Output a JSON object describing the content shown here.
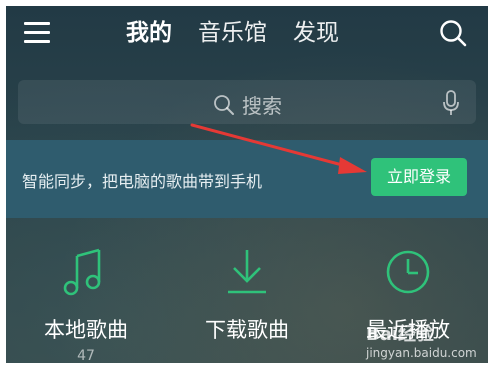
{
  "header": {
    "tabs": [
      {
        "label": "我的",
        "active": true
      },
      {
        "label": "音乐馆",
        "active": false
      },
      {
        "label": "发现",
        "active": false
      }
    ],
    "menu_icon": "hamburger-menu-icon",
    "search_icon": "search-icon"
  },
  "search": {
    "placeholder": "搜索",
    "icon": "search-icon",
    "voice_icon": "microphone-icon"
  },
  "banner": {
    "text": "智能同步，把电脑的歌曲带到手机",
    "button_label": "立即登录",
    "button_color": "#2fc27a"
  },
  "shortcuts": [
    {
      "label": "本地歌曲",
      "count": "47",
      "icon": "music-note-icon"
    },
    {
      "label": "下载歌曲",
      "count": "",
      "icon": "download-icon"
    },
    {
      "label": "最近播放",
      "count": "",
      "icon": "clock-icon"
    }
  ],
  "watermark": {
    "brand": "Bai",
    "brand_suffix": "经验",
    "url": "jingyan.baidu.com"
  },
  "colors": {
    "accent_green": "#2fc27a",
    "annotation_arrow": "#e53935"
  }
}
